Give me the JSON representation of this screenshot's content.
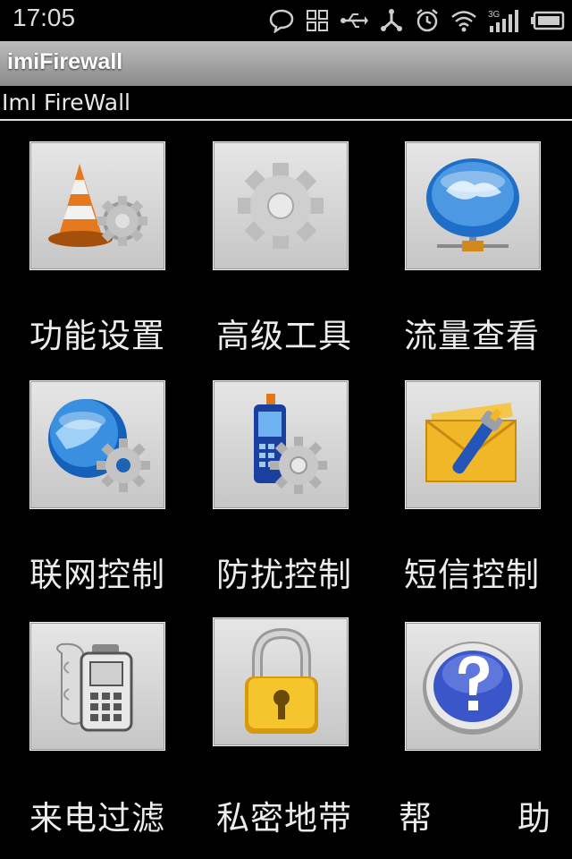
{
  "status_bar": {
    "time": "17:05",
    "network_label": "3G",
    "icons": [
      "chat-bubble-icon",
      "grid-icon",
      "usb-icon",
      "share-icon",
      "alarm-icon",
      "wifi-icon",
      "signal-3g-icon",
      "battery-icon"
    ]
  },
  "app": {
    "title": "imiFirewall",
    "subtitle": "ImI FireWall"
  },
  "menu": {
    "items": [
      {
        "label": "功能设置",
        "icon": "traffic-cone-gear-icon"
      },
      {
        "label": "高级工具",
        "icon": "gear-icon"
      },
      {
        "label": "流量查看",
        "icon": "network-globe-icon"
      },
      {
        "label": "联网控制",
        "icon": "globe-gear-icon"
      },
      {
        "label": "防扰控制",
        "icon": "phone-gear-icon"
      },
      {
        "label": "短信控制",
        "icon": "envelope-wrench-icon"
      },
      {
        "label": "来电过滤",
        "icon": "phone-scroll-icon"
      },
      {
        "label": "私密地带",
        "icon": "padlock-icon"
      },
      {
        "label": "帮",
        "label2": "助",
        "icon": "help-question-icon"
      }
    ]
  },
  "colors": {
    "background": "#000000",
    "titlebar": "#a8a8a8",
    "tile": "#d4d4d4"
  }
}
